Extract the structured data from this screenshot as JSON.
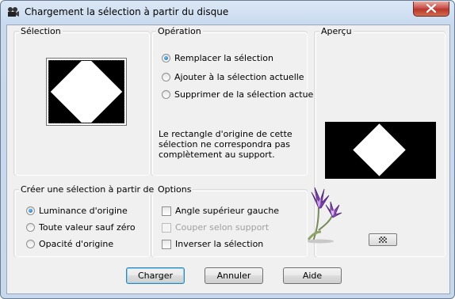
{
  "window": {
    "title": "Chargement la sélection à partir du disque",
    "close_symbol": "✕",
    "title_icon": "film-camera-icon"
  },
  "selection_group": {
    "legend": "Sélection",
    "thumbnail": "black-square-white-diamond"
  },
  "operation_group": {
    "legend": "Opération",
    "options": [
      {
        "label": "Remplacer la sélection",
        "checked": true
      },
      {
        "label": "Ajouter à la sélection actuelle",
        "checked": false
      },
      {
        "label": "Supprimer de la sélection actuelle",
        "checked": false
      }
    ],
    "info": "Le rectangle d'origine de cette sélection ne correspondra pas complètement au support."
  },
  "preview_group": {
    "legend": "Aperçu",
    "decoration_icon": "purple-flower-icon",
    "toggle_icon": "checkerboard-icon"
  },
  "create_group": {
    "legend": "Créer une sélection à partir de :",
    "options": [
      {
        "label": "Luminance d'origine",
        "checked": true
      },
      {
        "label": "Toute valeur sauf zéro",
        "checked": false
      },
      {
        "label": "Opacité d'origine",
        "checked": false
      }
    ]
  },
  "options_group": {
    "legend": "Options",
    "items": [
      {
        "label": "Angle supérieur gauche",
        "checked": false,
        "enabled": true
      },
      {
        "label": "Couper selon support",
        "checked": false,
        "enabled": false
      },
      {
        "label": "Inverser la sélection",
        "checked": false,
        "enabled": true
      }
    ]
  },
  "buttons": {
    "load": "Charger",
    "cancel": "Annuler",
    "help": "Aide"
  }
}
